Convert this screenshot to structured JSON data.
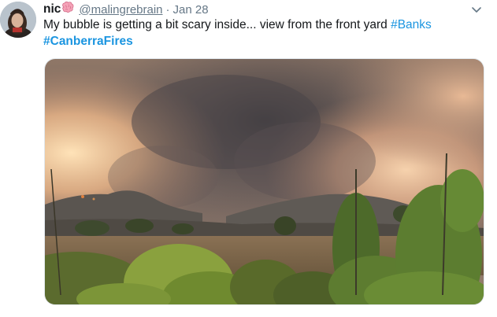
{
  "author": {
    "name": "nic",
    "handle": "@malingrebrain",
    "separator": "·",
    "date": "Jan 28"
  },
  "tweet": {
    "text": "My bubble is getting a bit scary inside... view from the front yard ",
    "hashtags": [
      "#Banks",
      "#CanberraFires"
    ]
  },
  "icons": {
    "name_emoji": "brain-emoji",
    "menu": "chevron-down-icon"
  },
  "colors": {
    "link": "#1b95e0",
    "secondary_text": "#657786",
    "primary_text": "#14171a"
  }
}
